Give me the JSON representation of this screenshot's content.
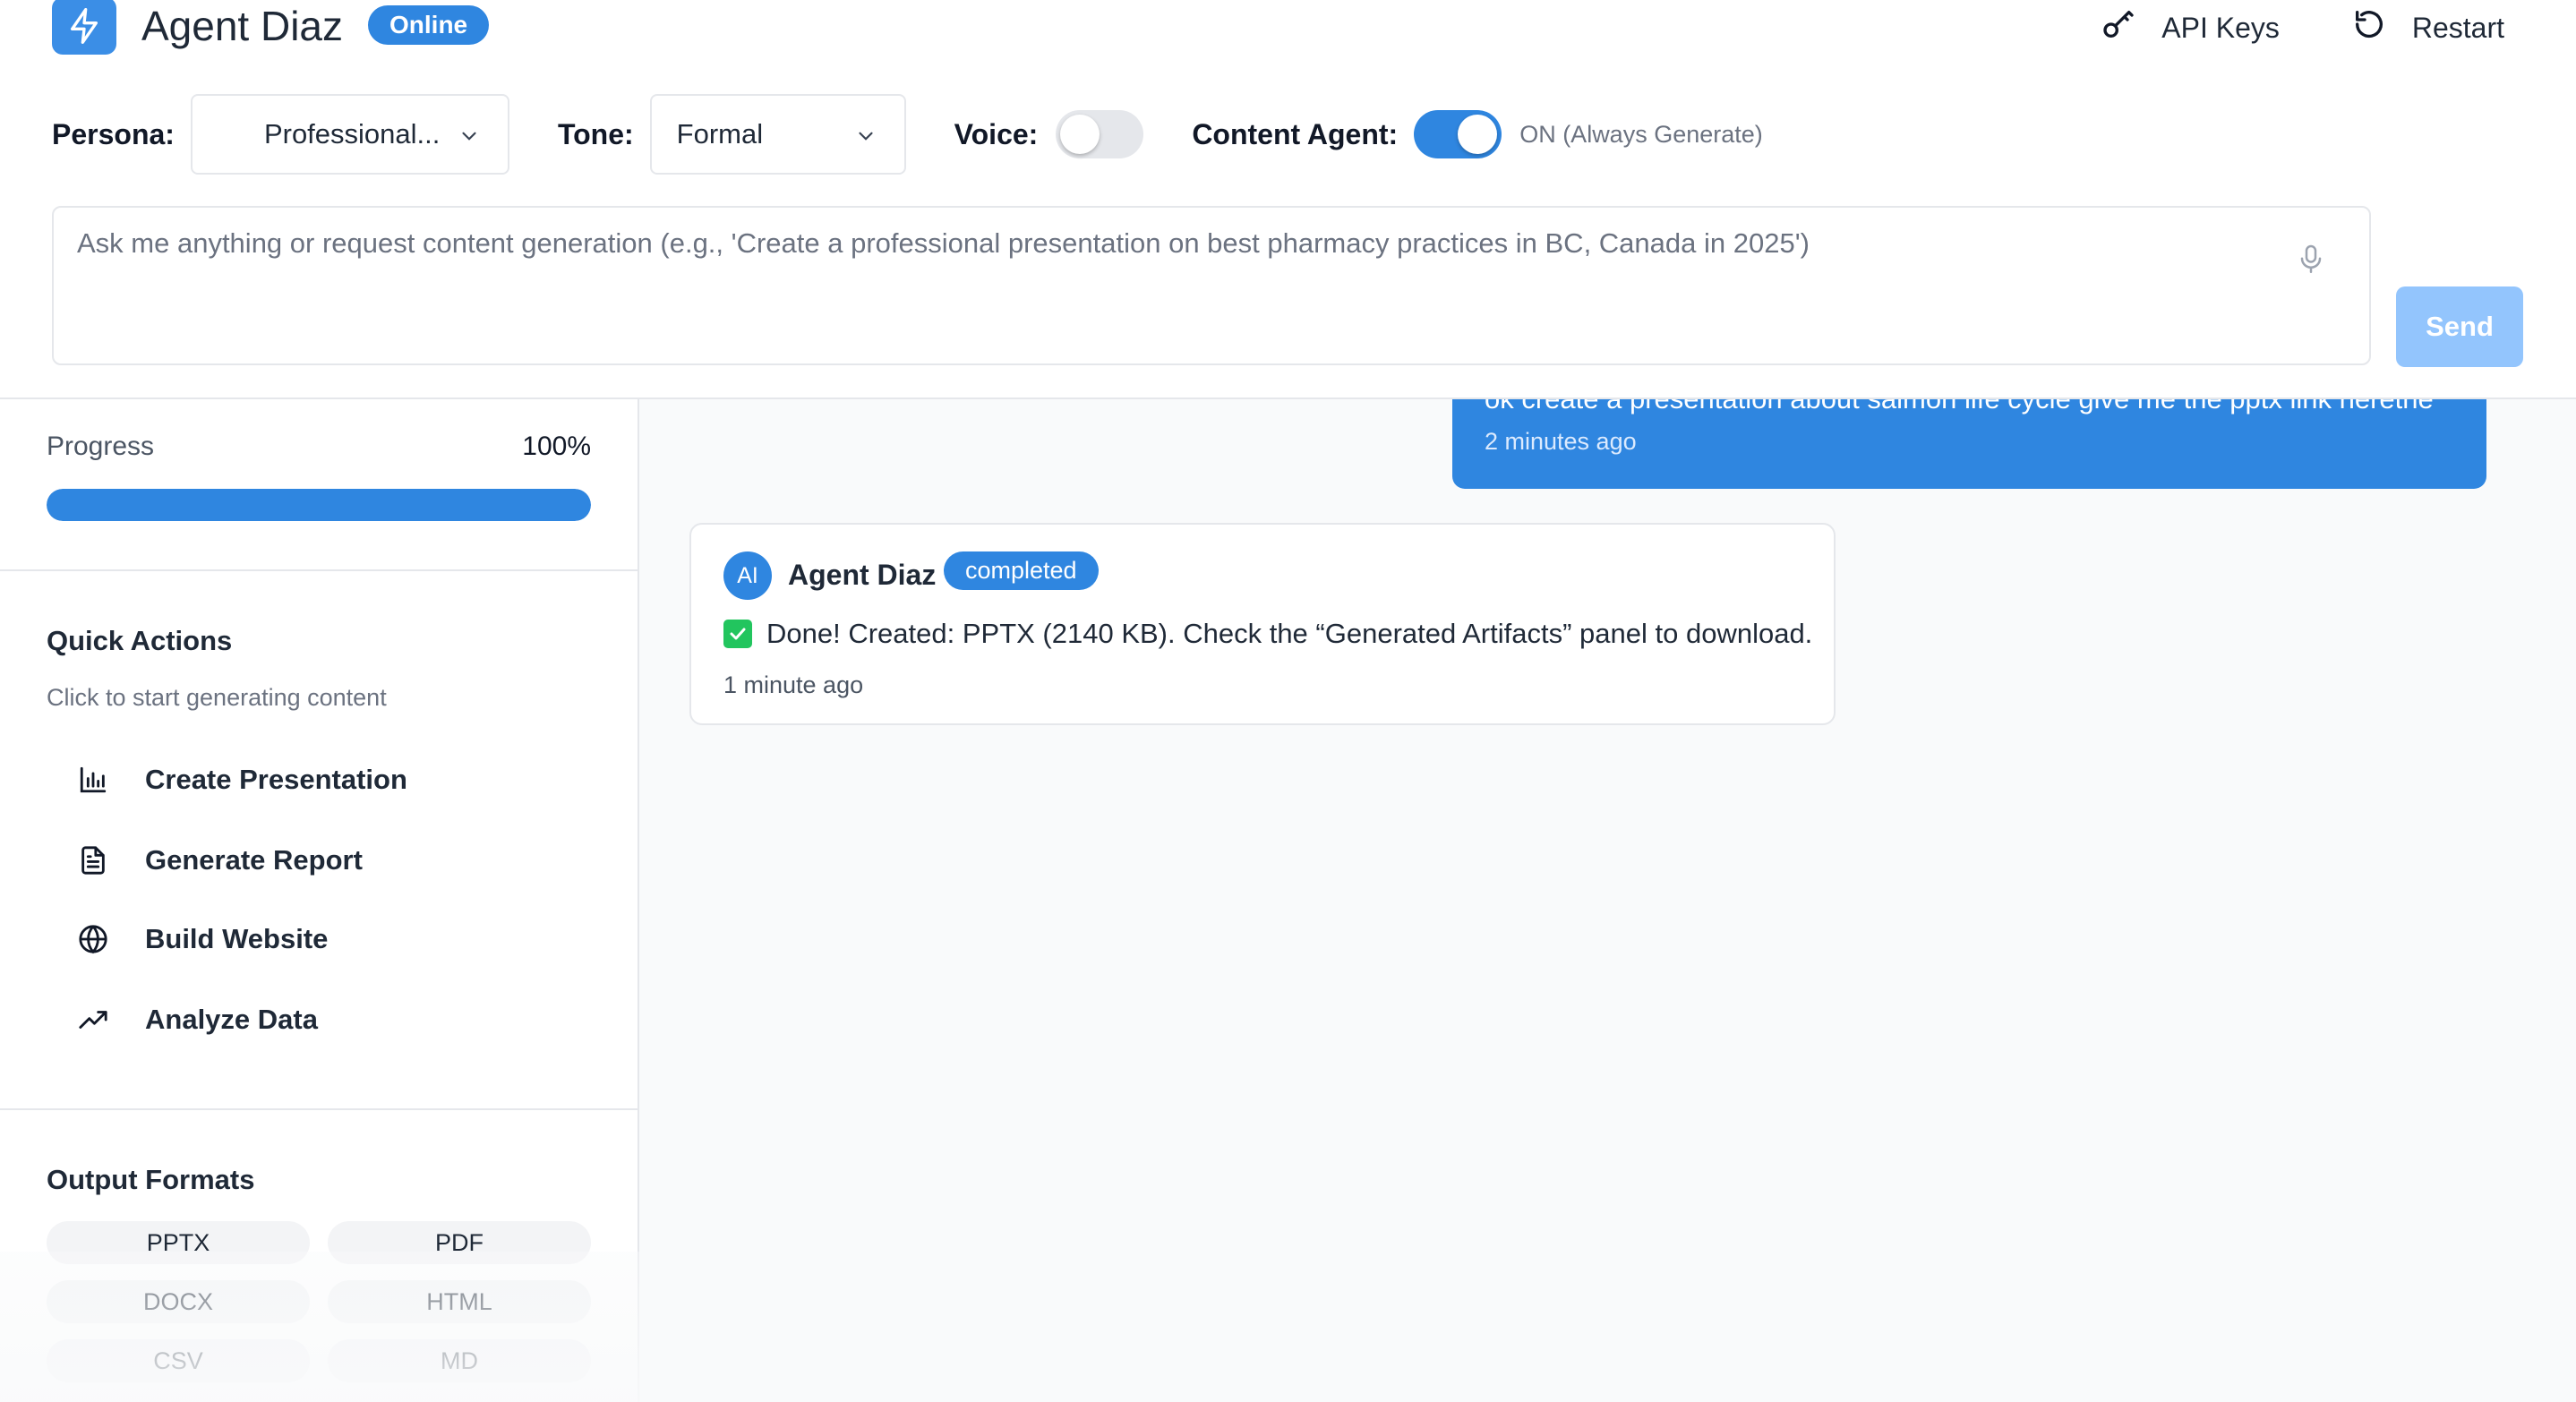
{
  "header": {
    "title": "Agent Diaz",
    "status": "Online",
    "actions": {
      "api_keys": "API Keys",
      "restart": "Restart"
    }
  },
  "controls": {
    "persona_label": "Persona:",
    "persona_value": "Professional...",
    "tone_label": "Tone:",
    "tone_value": "Formal",
    "voice_label": "Voice:",
    "voice_on": false,
    "content_agent_label": "Content Agent:",
    "content_agent_on": true,
    "content_agent_status": "ON (Always Generate)"
  },
  "prompt": {
    "placeholder": "Ask me anything or request content generation (e.g., 'Create a professional presentation on best pharmacy practices in BC, Canada in 2025')",
    "send_label": "Send"
  },
  "sidebar": {
    "progress_label": "Progress",
    "progress_value": "100%",
    "progress_fraction": 1.0,
    "quick_actions_title": "Quick Actions",
    "quick_actions_subtitle": "Click to start generating content",
    "quick_actions": [
      {
        "label": "Create Presentation",
        "icon": "bar-chart-icon"
      },
      {
        "label": "Generate Report",
        "icon": "document-icon"
      },
      {
        "label": "Build Website",
        "icon": "globe-icon"
      },
      {
        "label": "Analyze Data",
        "icon": "trending-up-icon"
      }
    ],
    "output_formats_title": "Output Formats",
    "output_formats": [
      "PPTX",
      "PDF",
      "DOCX",
      "HTML",
      "CSV",
      "MD"
    ]
  },
  "chat": {
    "user_message": {
      "text": "ok create a presentation about salmon life cycle give me the pptx link herethe",
      "time": "2 minutes ago"
    },
    "agent_message": {
      "avatar": "AI",
      "name": "Agent Diaz",
      "status": "completed",
      "text": "Done! Created: PPTX (2140 KB). Check the “Generated Artifacts” panel to download.",
      "time": "1 minute ago"
    }
  },
  "colors": {
    "accent": "#2f86e0",
    "send_disabled": "#93c5fd",
    "success": "#22c55e"
  }
}
